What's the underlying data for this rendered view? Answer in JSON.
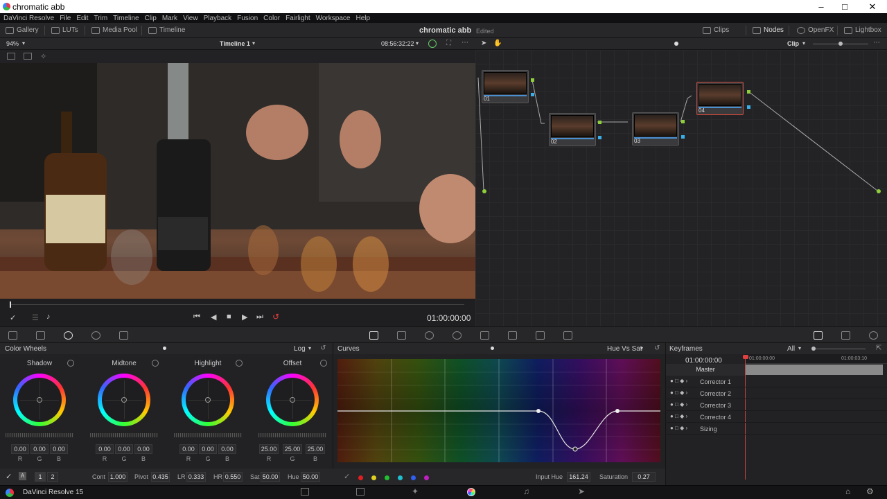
{
  "window": {
    "title": "chromatic abb",
    "app_name": "DaVinci Resolve 15"
  },
  "menu": [
    "DaVinci Resolve",
    "File",
    "Edit",
    "Trim",
    "Timeline",
    "Clip",
    "Mark",
    "View",
    "Playback",
    "Fusion",
    "Color",
    "Fairlight",
    "Workspace",
    "Help"
  ],
  "toolbar": {
    "gallery": "Gallery",
    "luts": "LUTs",
    "media_pool": "Media Pool",
    "timeline": "Timeline",
    "project": "chromatic abb",
    "status": "Edited",
    "clips": "Clips",
    "nodes": "Nodes",
    "openfx": "OpenFX",
    "lightbox": "Lightbox"
  },
  "viewer": {
    "zoom": "94%",
    "timeline_name": "Timeline 1",
    "timecode": "08:56:32:22",
    "playhead_tc": "01:00:00:00"
  },
  "node_editor": {
    "mode": "Clip",
    "nodes": [
      {
        "label": "01"
      },
      {
        "label": "02"
      },
      {
        "label": "03"
      },
      {
        "label": "04"
      }
    ]
  },
  "color_wheels": {
    "title": "Color Wheels",
    "mode": "Log",
    "wheels": [
      {
        "name": "Shadow",
        "r": "0.00",
        "g": "0.00",
        "b": "0.00"
      },
      {
        "name": "Midtone",
        "r": "0.00",
        "g": "0.00",
        "b": "0.00"
      },
      {
        "name": "Highlight",
        "r": "0.00",
        "g": "0.00",
        "b": "0.00"
      },
      {
        "name": "Offset",
        "r": "25.00",
        "g": "25.00",
        "b": "25.00"
      }
    ],
    "rgb": {
      "r": "R",
      "g": "G",
      "b": "B"
    },
    "footer": {
      "page1": "1",
      "page2": "2",
      "cont_label": "Cont",
      "cont": "1.000",
      "pivot_label": "Pivot",
      "pivot": "0.435",
      "lr_label": "LR",
      "lr": "0.333",
      "hr_label": "HR",
      "hr": "0.550",
      "sat_label": "Sat",
      "sat": "50.00",
      "hue_label": "Hue",
      "hue": "50.00"
    }
  },
  "curves": {
    "title": "Curves",
    "mode": "Hue Vs Sat",
    "input_hue_label": "Input Hue",
    "input_hue": "161.24",
    "saturation_label": "Saturation",
    "saturation": "0.27",
    "dot_colors": [
      "#e02020",
      "#e0d020",
      "#20c030",
      "#20c0d0",
      "#3060f0",
      "#c020c0"
    ]
  },
  "keyframes": {
    "title": "Keyframes",
    "filter": "All",
    "timecode": "01:00:00:00",
    "ruler_start": "01:00:00:00",
    "ruler_end": "01:00:03:10",
    "tracks": [
      "Master",
      "Corrector 1",
      "Corrector 2",
      "Corrector 3",
      "Corrector 4",
      "Sizing"
    ]
  }
}
